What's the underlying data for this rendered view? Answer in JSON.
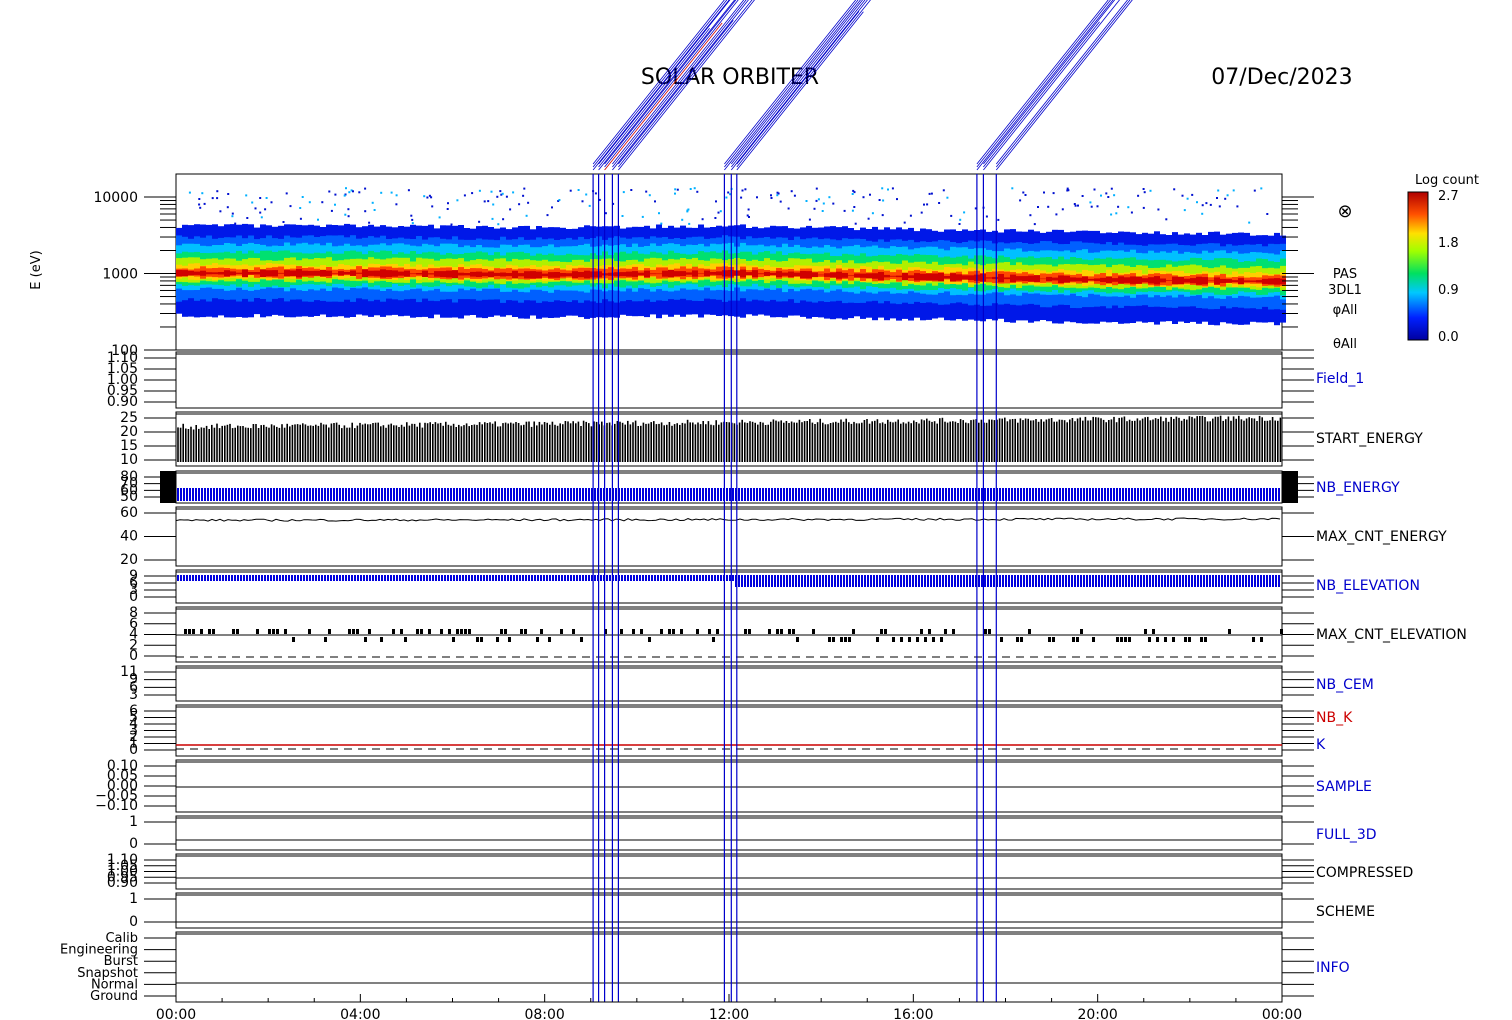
{
  "header": {
    "mission": "SOLAR ORBITER",
    "date": "07/Dec/2023"
  },
  "spectrogram": {
    "ylabel": "E (eV)",
    "yticks": [
      "10000",
      "1000",
      "100"
    ],
    "side_labels": [
      "PAS",
      "3DL1",
      "φAll",
      "θAll"
    ],
    "sun_symbol": "⊗",
    "colorbar": {
      "title": "Log count",
      "ticks": [
        "2.7",
        "1.8",
        "0.9",
        "0.0"
      ],
      "range": [
        0.0,
        2.7
      ]
    }
  },
  "panels": [
    {
      "name": "Field_1",
      "label": "Field_1",
      "label_color": "#0000cc",
      "ticks": [
        "1.10",
        "1.05",
        "1.00",
        "0.95",
        "0.90"
      ],
      "value": 1.0
    },
    {
      "name": "START_ENERGY",
      "label": "START_ENERGY",
      "label_color": "#000000",
      "ticks": [
        "25",
        "20",
        "15",
        "10"
      ],
      "range": [
        10,
        25
      ]
    },
    {
      "name": "NB_ENERGY",
      "label": "NB_ENERGY",
      "label_color": "#0000cc",
      "ticks": [
        "80",
        "70",
        "60",
        "50"
      ],
      "value": 64
    },
    {
      "name": "MAX_CNT_ENERGY",
      "label": "MAX_CNT_ENERGY",
      "label_color": "#000000",
      "ticks": [
        "60",
        "40",
        "20"
      ],
      "value": 52
    },
    {
      "name": "NB_ELEVATION",
      "label": "NB_ELEVATION",
      "label_color": "#0000cc",
      "ticks": [
        "9",
        "6",
        "3",
        "0"
      ],
      "value": 9
    },
    {
      "name": "MAX_CNT_ELEVATION",
      "label": "MAX_CNT_ELEVATION",
      "label_color": "#000000",
      "ticks": [
        "8",
        "6",
        "4",
        "2",
        "0"
      ],
      "value": 4
    },
    {
      "name": "NB_CEM",
      "label": "NB_CEM",
      "label_color": "#0000cc",
      "ticks": [
        "11",
        "9",
        "6",
        "3"
      ]
    },
    {
      "name": "NB_K",
      "label": "NB_K",
      "label_color": "#cc0000",
      "extra_label": "K",
      "extra_color": "#0000cc",
      "ticks": [
        "6",
        "5",
        "4",
        "3",
        "2",
        "1",
        "0"
      ],
      "value": 1
    },
    {
      "name": "SAMPLE",
      "label": "SAMPLE",
      "label_color": "#0000cc",
      "ticks": [
        "0.10",
        "0.05",
        "0.00",
        "−0.05",
        "−0.10"
      ]
    },
    {
      "name": "FULL_3D",
      "label": "FULL_3D",
      "label_color": "#0000cc",
      "ticks": [
        "1",
        "0"
      ]
    },
    {
      "name": "COMPRESSED",
      "label": "COMPRESSED",
      "label_color": "#000000",
      "ticks": [
        "1.10",
        "1.05",
        "1.00",
        "0.95",
        "0.90"
      ]
    },
    {
      "name": "SCHEME",
      "label": "SCHEME",
      "label_color": "#000000",
      "ticks": [
        "1",
        "0"
      ]
    },
    {
      "name": "INFO",
      "label": "INFO",
      "label_color": "#0000cc",
      "ticks": [
        "Calib",
        "Engineering",
        "Burst",
        "Snapshot",
        "Normal",
        "Ground"
      ]
    }
  ],
  "xaxis": {
    "ticks": [
      "00:00",
      "04:00",
      "08:00",
      "12:00",
      "16:00",
      "20:00",
      "00:00"
    ],
    "range_hours": [
      0,
      24
    ]
  },
  "chart_data": {
    "type": "heatmap",
    "title": "SOLAR ORBITER",
    "date": "07/Dec/2023",
    "xlabel": "",
    "ylabel": "E (eV)",
    "x_range_hours": [
      0,
      24
    ],
    "y_range_ev": [
      100,
      20000
    ],
    "y_scale": "log",
    "colorbar": {
      "label": "Log count",
      "min": 0.0,
      "max": 2.7
    },
    "spectrum_peak_ev": [
      {
        "t": 0,
        "peak": 1000
      },
      {
        "t": 4,
        "peak": 1000
      },
      {
        "t": 8,
        "peak": 950
      },
      {
        "t": 10,
        "peak": 980
      },
      {
        "t": 12,
        "peak": 1000
      },
      {
        "t": 16,
        "peak": 900
      },
      {
        "t": 20,
        "peak": 820
      },
      {
        "t": 24,
        "peak": 780
      }
    ],
    "event_markers_hours": [
      9.05,
      9.17,
      9.3,
      9.47,
      9.6,
      11.9,
      12.05,
      12.17,
      17.38,
      17.52,
      17.8
    ],
    "series": [
      {
        "name": "START_ENERGY",
        "range": [
          10,
          25
        ]
      },
      {
        "name": "NB_ENERGY",
        "value": 64
      },
      {
        "name": "MAX_CNT_ENERGY",
        "value": 52
      },
      {
        "name": "NB_ELEVATION",
        "value": 9
      },
      {
        "name": "MAX_CNT_ELEVATION",
        "value": 4
      },
      {
        "name": "NB_K",
        "value": 1
      }
    ]
  }
}
